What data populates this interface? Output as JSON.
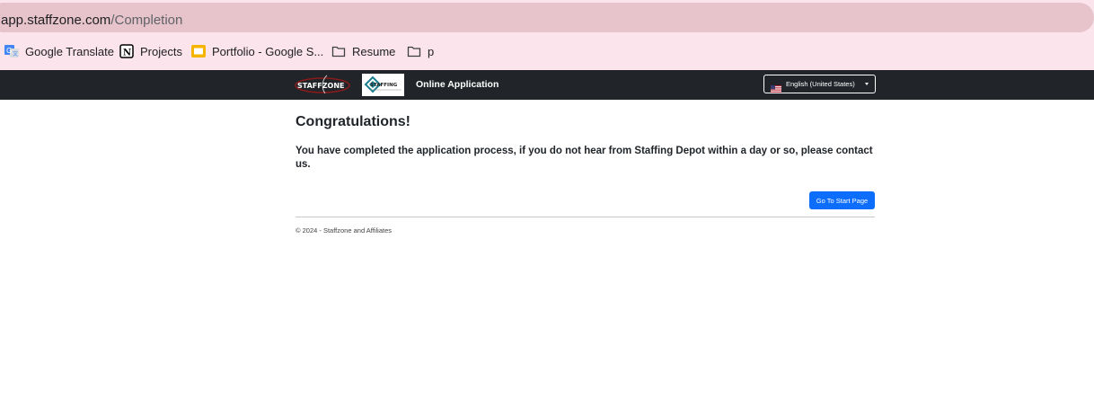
{
  "browser": {
    "url_domain": "app.staffzone.com",
    "url_path": "/Completion"
  },
  "bookmarks": [
    {
      "label": "Google Translate",
      "icon": "google-translate-icon"
    },
    {
      "label": "Projects",
      "icon": "notion-icon"
    },
    {
      "label": "Portfolio - Google S...",
      "icon": "google-slides-icon"
    },
    {
      "label": "Resume",
      "icon": "folder-icon"
    },
    {
      "label": "p",
      "icon": "folder-icon"
    }
  ],
  "navbar": {
    "logo1_text": "STAFFZONE",
    "logo2_text": "STAFFING",
    "title": "Online Application",
    "language": "English (United States)"
  },
  "main": {
    "heading": "Congratulations!",
    "message": "You have completed the application process, if you do not hear from Staffing Depot within a day or so, please contact us.",
    "start_button": "Go To Start Page"
  },
  "footer": {
    "text": "© 2024 - Staffzone and Affiliates"
  },
  "colors": {
    "navbar_bg": "#212529",
    "primary_button": "#0d6efd",
    "browser_bar": "#fce4ec"
  }
}
